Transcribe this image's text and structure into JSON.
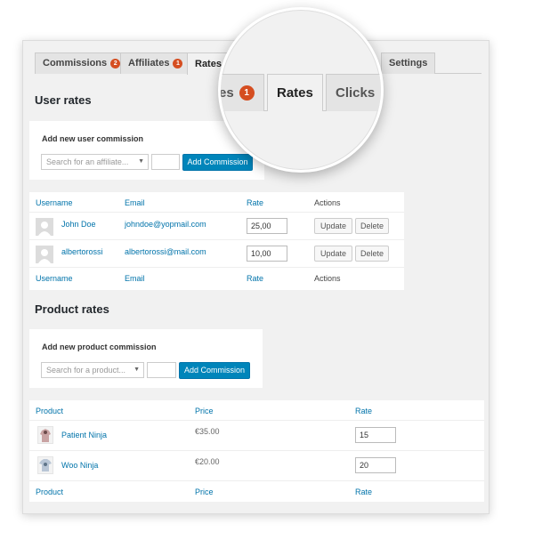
{
  "tabs": [
    {
      "label": "Commissions",
      "badge": "2"
    },
    {
      "label": "Affiliates",
      "badge": "1"
    },
    {
      "label": "Rates",
      "badge": ""
    },
    {
      "label": "Settings",
      "badge": ""
    }
  ],
  "magnified": {
    "partial_label": "es",
    "badge": "1",
    "active_label": "Rates",
    "next_label": "Clicks"
  },
  "user_rates": {
    "heading": "User rates",
    "add_title": "Add new user commission",
    "search_placeholder": "Search for an affiliate...",
    "add_button": "Add Commission",
    "columns": {
      "username": "Username",
      "email": "Email",
      "rate": "Rate",
      "actions": "Actions"
    },
    "rows": [
      {
        "username": "John Doe",
        "email": "johndoe@yopmail.com",
        "rate": "25,00"
      },
      {
        "username": "albertorossi",
        "email": "albertorossi@mail.com",
        "rate": "10,00"
      }
    ],
    "update_label": "Update",
    "delete_label": "Delete"
  },
  "product_rates": {
    "heading": "Product rates",
    "add_title": "Add new product commission",
    "search_placeholder": "Search for a product...",
    "add_button": "Add Commission",
    "columns": {
      "product": "Product",
      "price": "Price",
      "rate": "Rate"
    },
    "rows": [
      {
        "product": "Patient Ninja",
        "price": "€35.00",
        "rate": "15"
      },
      {
        "product": "Woo Ninja",
        "price": "€20.00",
        "rate": "20"
      }
    ]
  },
  "colors": {
    "accent": "#0073aa",
    "button": "#0085ba",
    "badge": "#d54e21"
  }
}
